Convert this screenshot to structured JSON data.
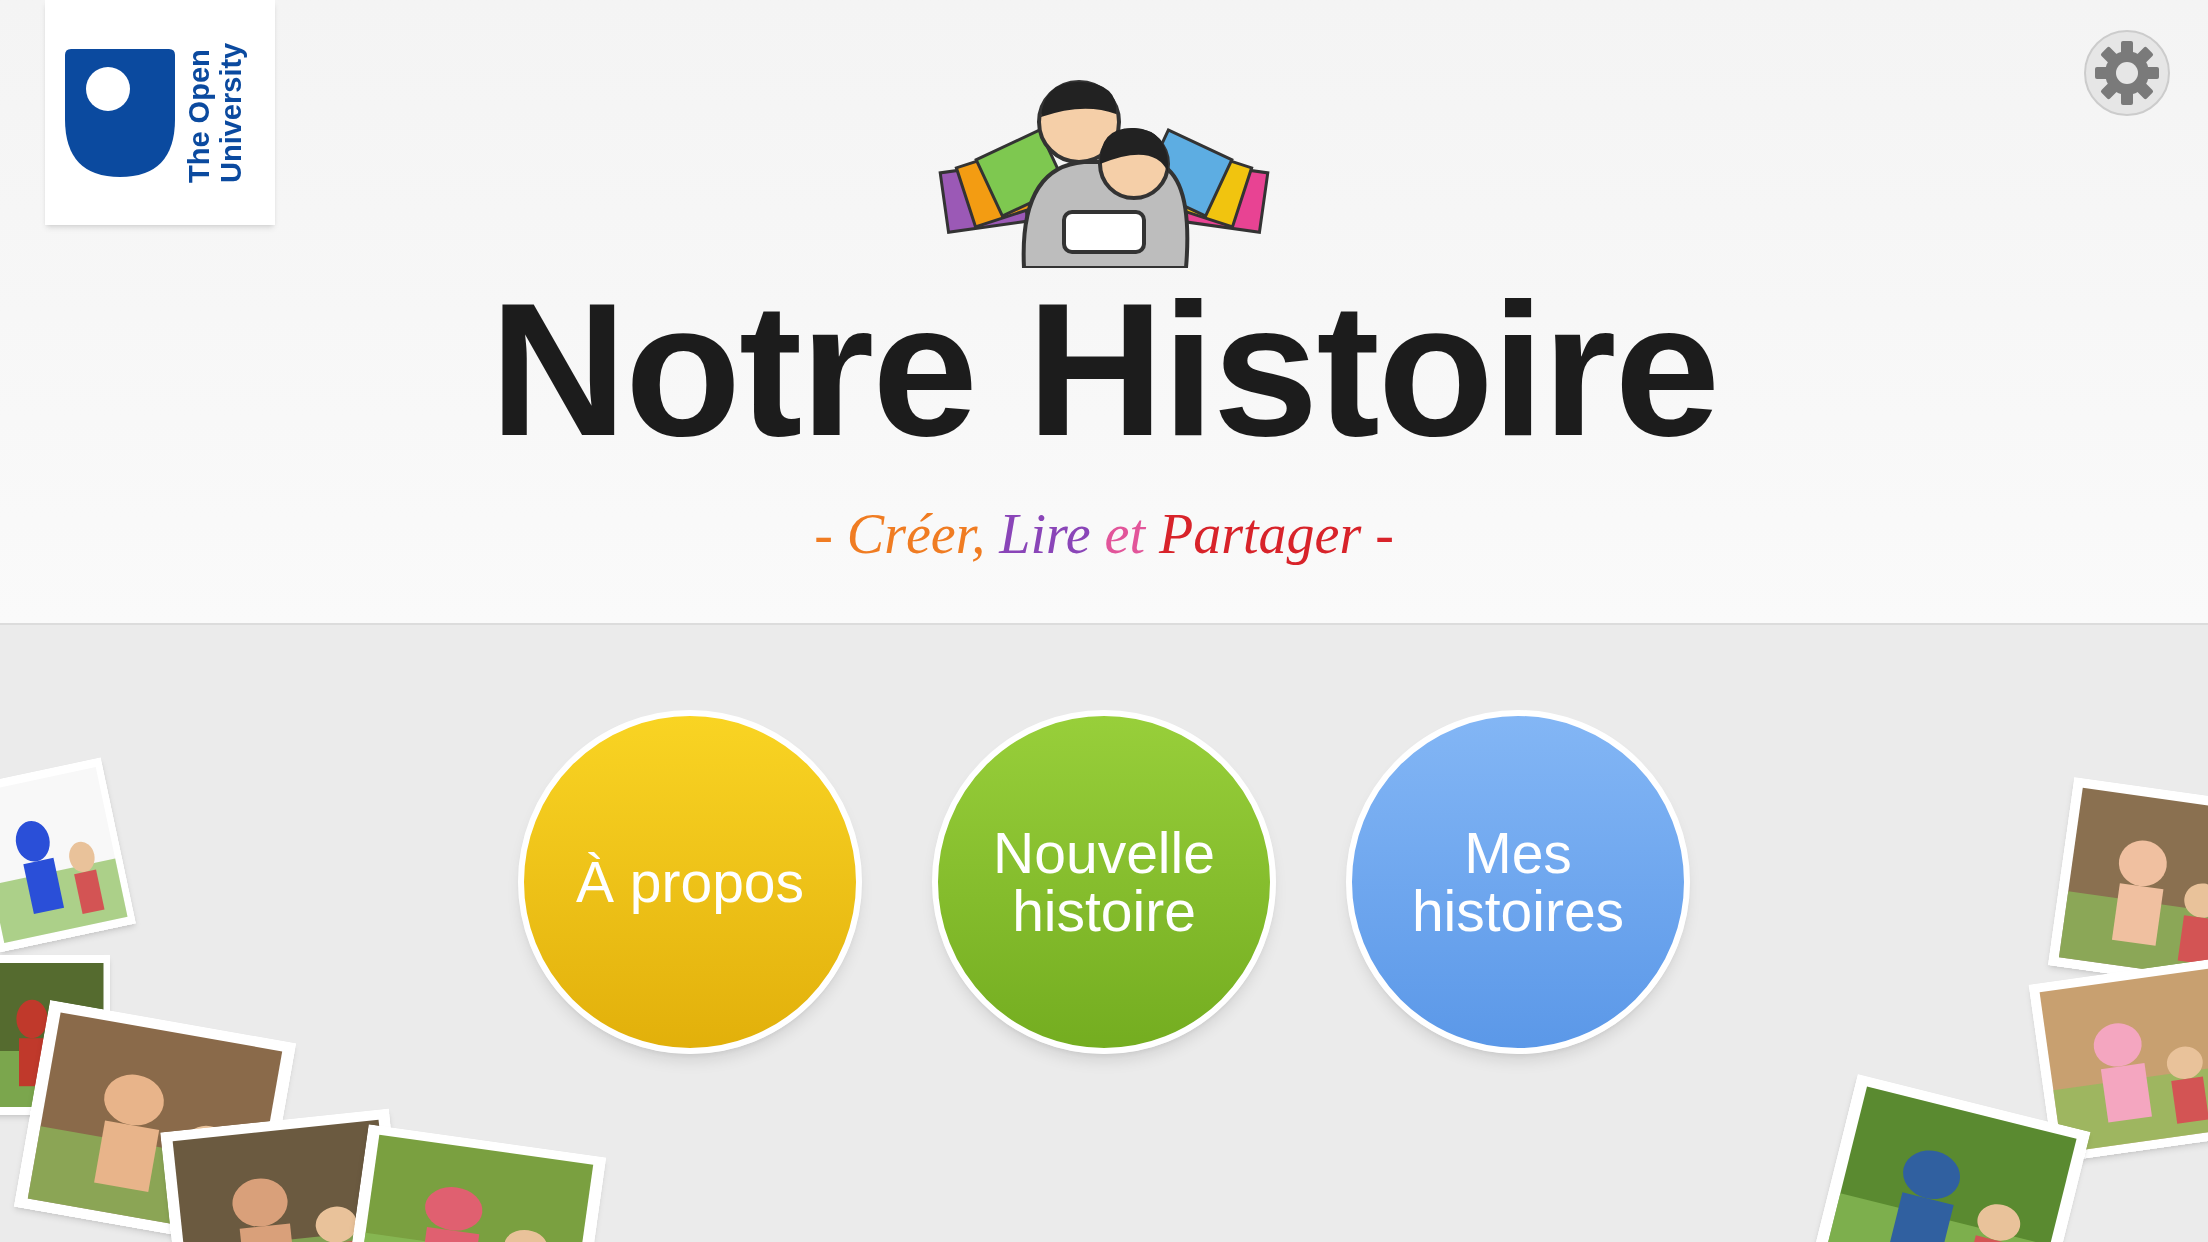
{
  "brand": {
    "name": "The Open University"
  },
  "title": "Notre Histoire",
  "subtitle": [
    {
      "text": "-",
      "color": "#f07c22"
    },
    {
      "text": "Créer,",
      "color": "#f07c22"
    },
    {
      "text": "Lire",
      "color": "#8a45b8"
    },
    {
      "text": "et",
      "color": "#e2559a"
    },
    {
      "text": "Partager",
      "color": "#d8232a"
    },
    {
      "text": "-",
      "color": "#d8232a"
    }
  ],
  "menu": [
    {
      "label": "À propos",
      "kind": "yellow"
    },
    {
      "label": "Nouvelle histoire",
      "kind": "green"
    },
    {
      "label": "Mes histoires",
      "kind": "blue"
    }
  ]
}
